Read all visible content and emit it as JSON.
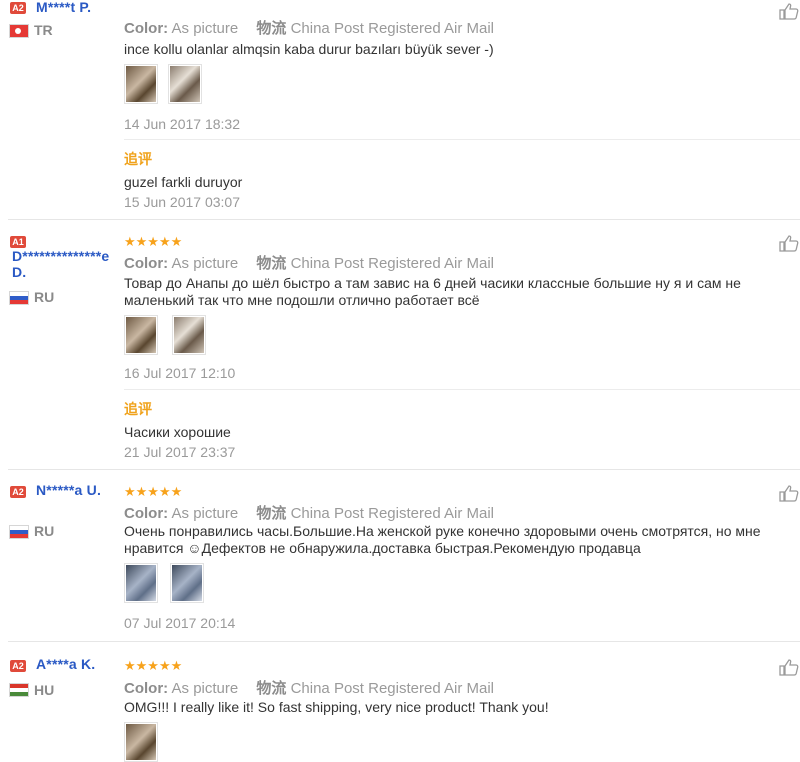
{
  "reviews": [
    {
      "badge": "A2",
      "name": "M****t P.",
      "country": "TR",
      "stars": "★★★★★",
      "color_label": "Color:",
      "color_value": "As picture",
      "ship_label": "物流",
      "ship_value": "China Post Registered Air Mail",
      "text": "ince kollu olanlar almqsin kaba durur bazıları büyük sever -)",
      "date": "14 Jun 2017 18:32",
      "follow_label": "追评",
      "follow_text": "guzel farkli duruyor",
      "follow_date": "15 Jun 2017 03:07"
    },
    {
      "badge": "A1",
      "name": "D**************e D.",
      "country": "RU",
      "stars": "★★★★★",
      "color_label": "Color:",
      "color_value": "As picture",
      "ship_label": "物流",
      "ship_value": "China Post Registered Air Mail",
      "text": "Товар до Анапы до шёл быстро а там завис на 6 дней часики классные большие ну я и сам не маленький так что мне подошли отлично работает всё",
      "date": "16 Jul 2017 12:10",
      "follow_label": "追评",
      "follow_text": "Часики хорошие",
      "follow_date": "21 Jul 2017 23:37"
    },
    {
      "badge": "A2",
      "name": "N*****a U.",
      "country": "RU",
      "stars": "★★★★★",
      "color_label": "Color:",
      "color_value": "As picture",
      "ship_label": "物流",
      "ship_value": "China Post Registered Air Mail",
      "text": "Очень понравились часы.Большие.На женской руке конечно здоровыми очень смотрятся, но мне нравится ☺Дефектов не обнаружила.доставка быстрая.Рекомендую продавца",
      "date": "07 Jul 2017 20:14"
    },
    {
      "badge": "A2",
      "name": "A****a K.",
      "country": "HU",
      "stars": "★★★★★",
      "color_label": "Color:",
      "color_value": "As picture",
      "ship_label": "物流",
      "ship_value": "China Post Registered Air Mail",
      "text": "OMG!!! I really like it! So fast shipping, very nice product! Thank you!"
    }
  ],
  "icons": {
    "like": "thumbs-up-icon"
  },
  "colors": {
    "stars": "#f7a21b",
    "name": "#2a59c4",
    "follow": "#f0a21b",
    "badge": "#e04a3a"
  }
}
